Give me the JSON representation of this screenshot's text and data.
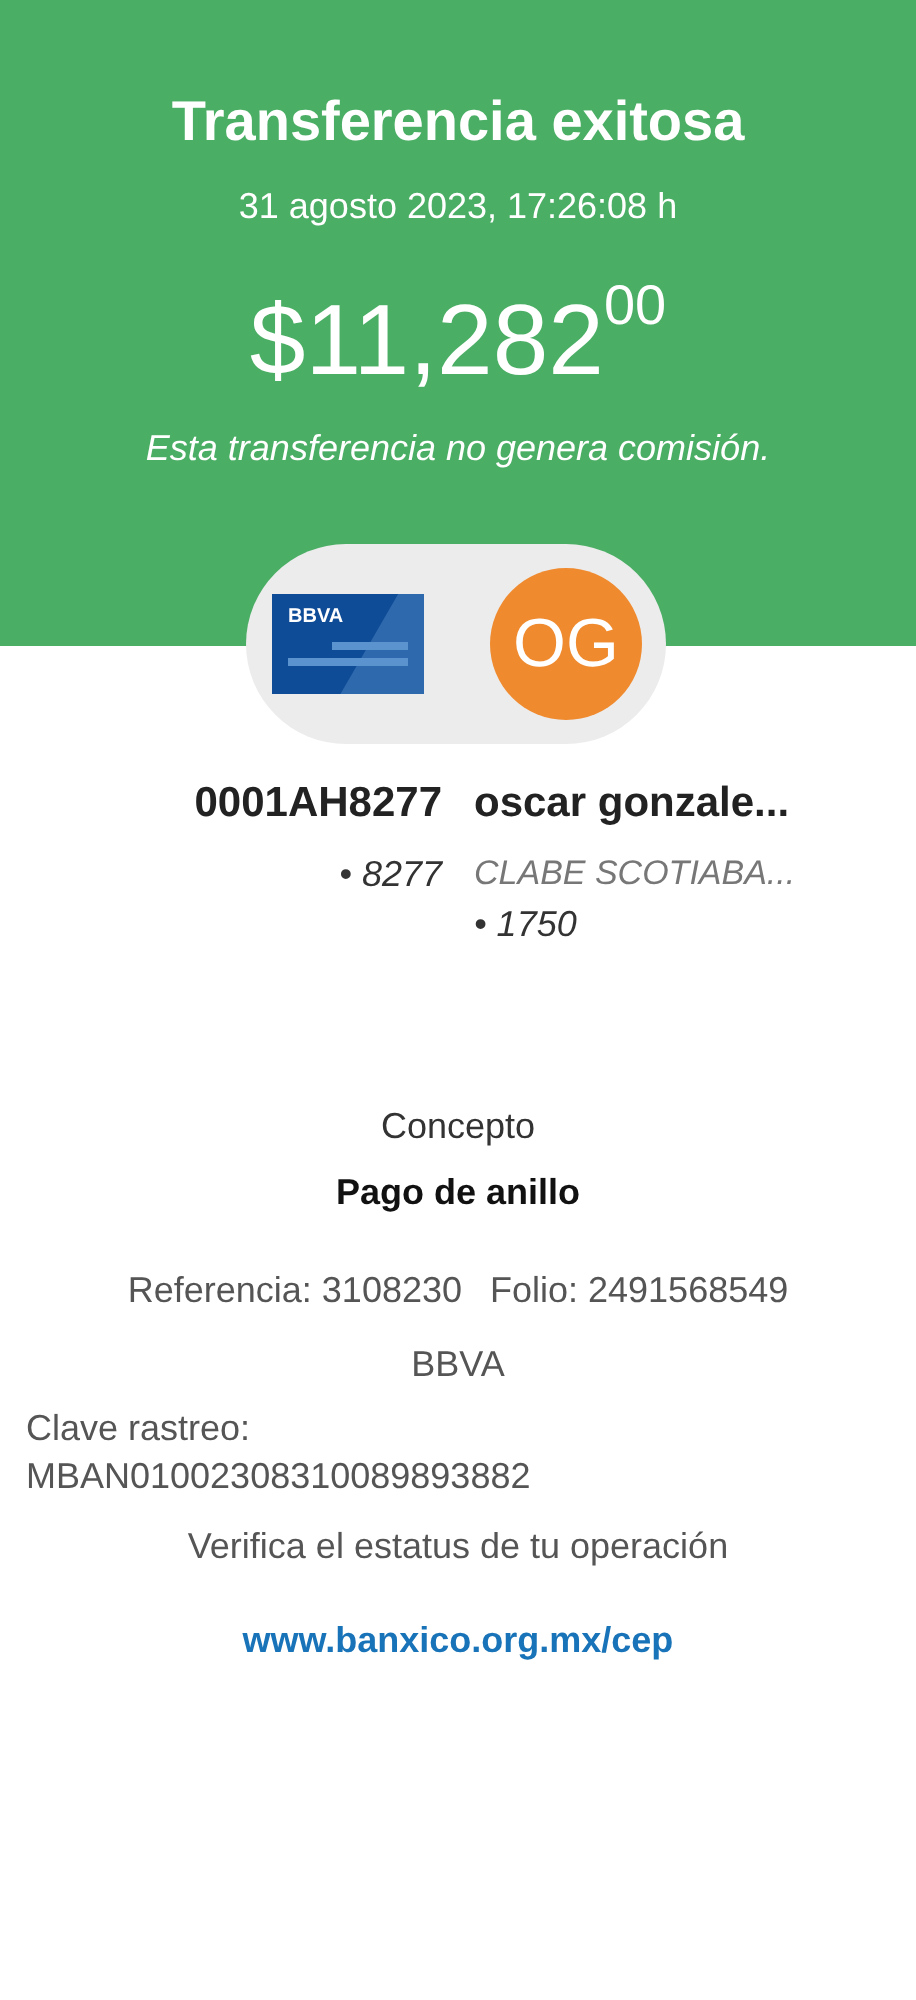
{
  "header": {
    "title": "Transferencia exitosa",
    "datetime": "31 agosto 2023, 17:26:08 h",
    "amount": "$11,282$^{00}$",
    "note": "Esta transferencia no genera comisión."
  },
  "origin": {
    "card_brand": "BBVA",
    "account": "0001AH8277",
    "detail": "• 8277"
  },
  "destination": {
    "initials": "OG",
    "name": "oscar gonzale...",
    "bank": "CLABE SCOTIABA...",
    "detail": "• 1750"
  },
  "concept": {
    "label": "Concepto",
    "value": "Pago de anillo"
  },
  "reference": "Referencia: 3108230",
  "folio": "Folio: 2491568549",
  "bank": "BBVA",
  "tracking": {
    "label": "Clave rastreo:",
    "value": "MBAN01002308310089893882"
  },
  "verify_text": "Verifica el estatus de tu operación",
  "link": "www.banxico.org.mx/cep"
}
